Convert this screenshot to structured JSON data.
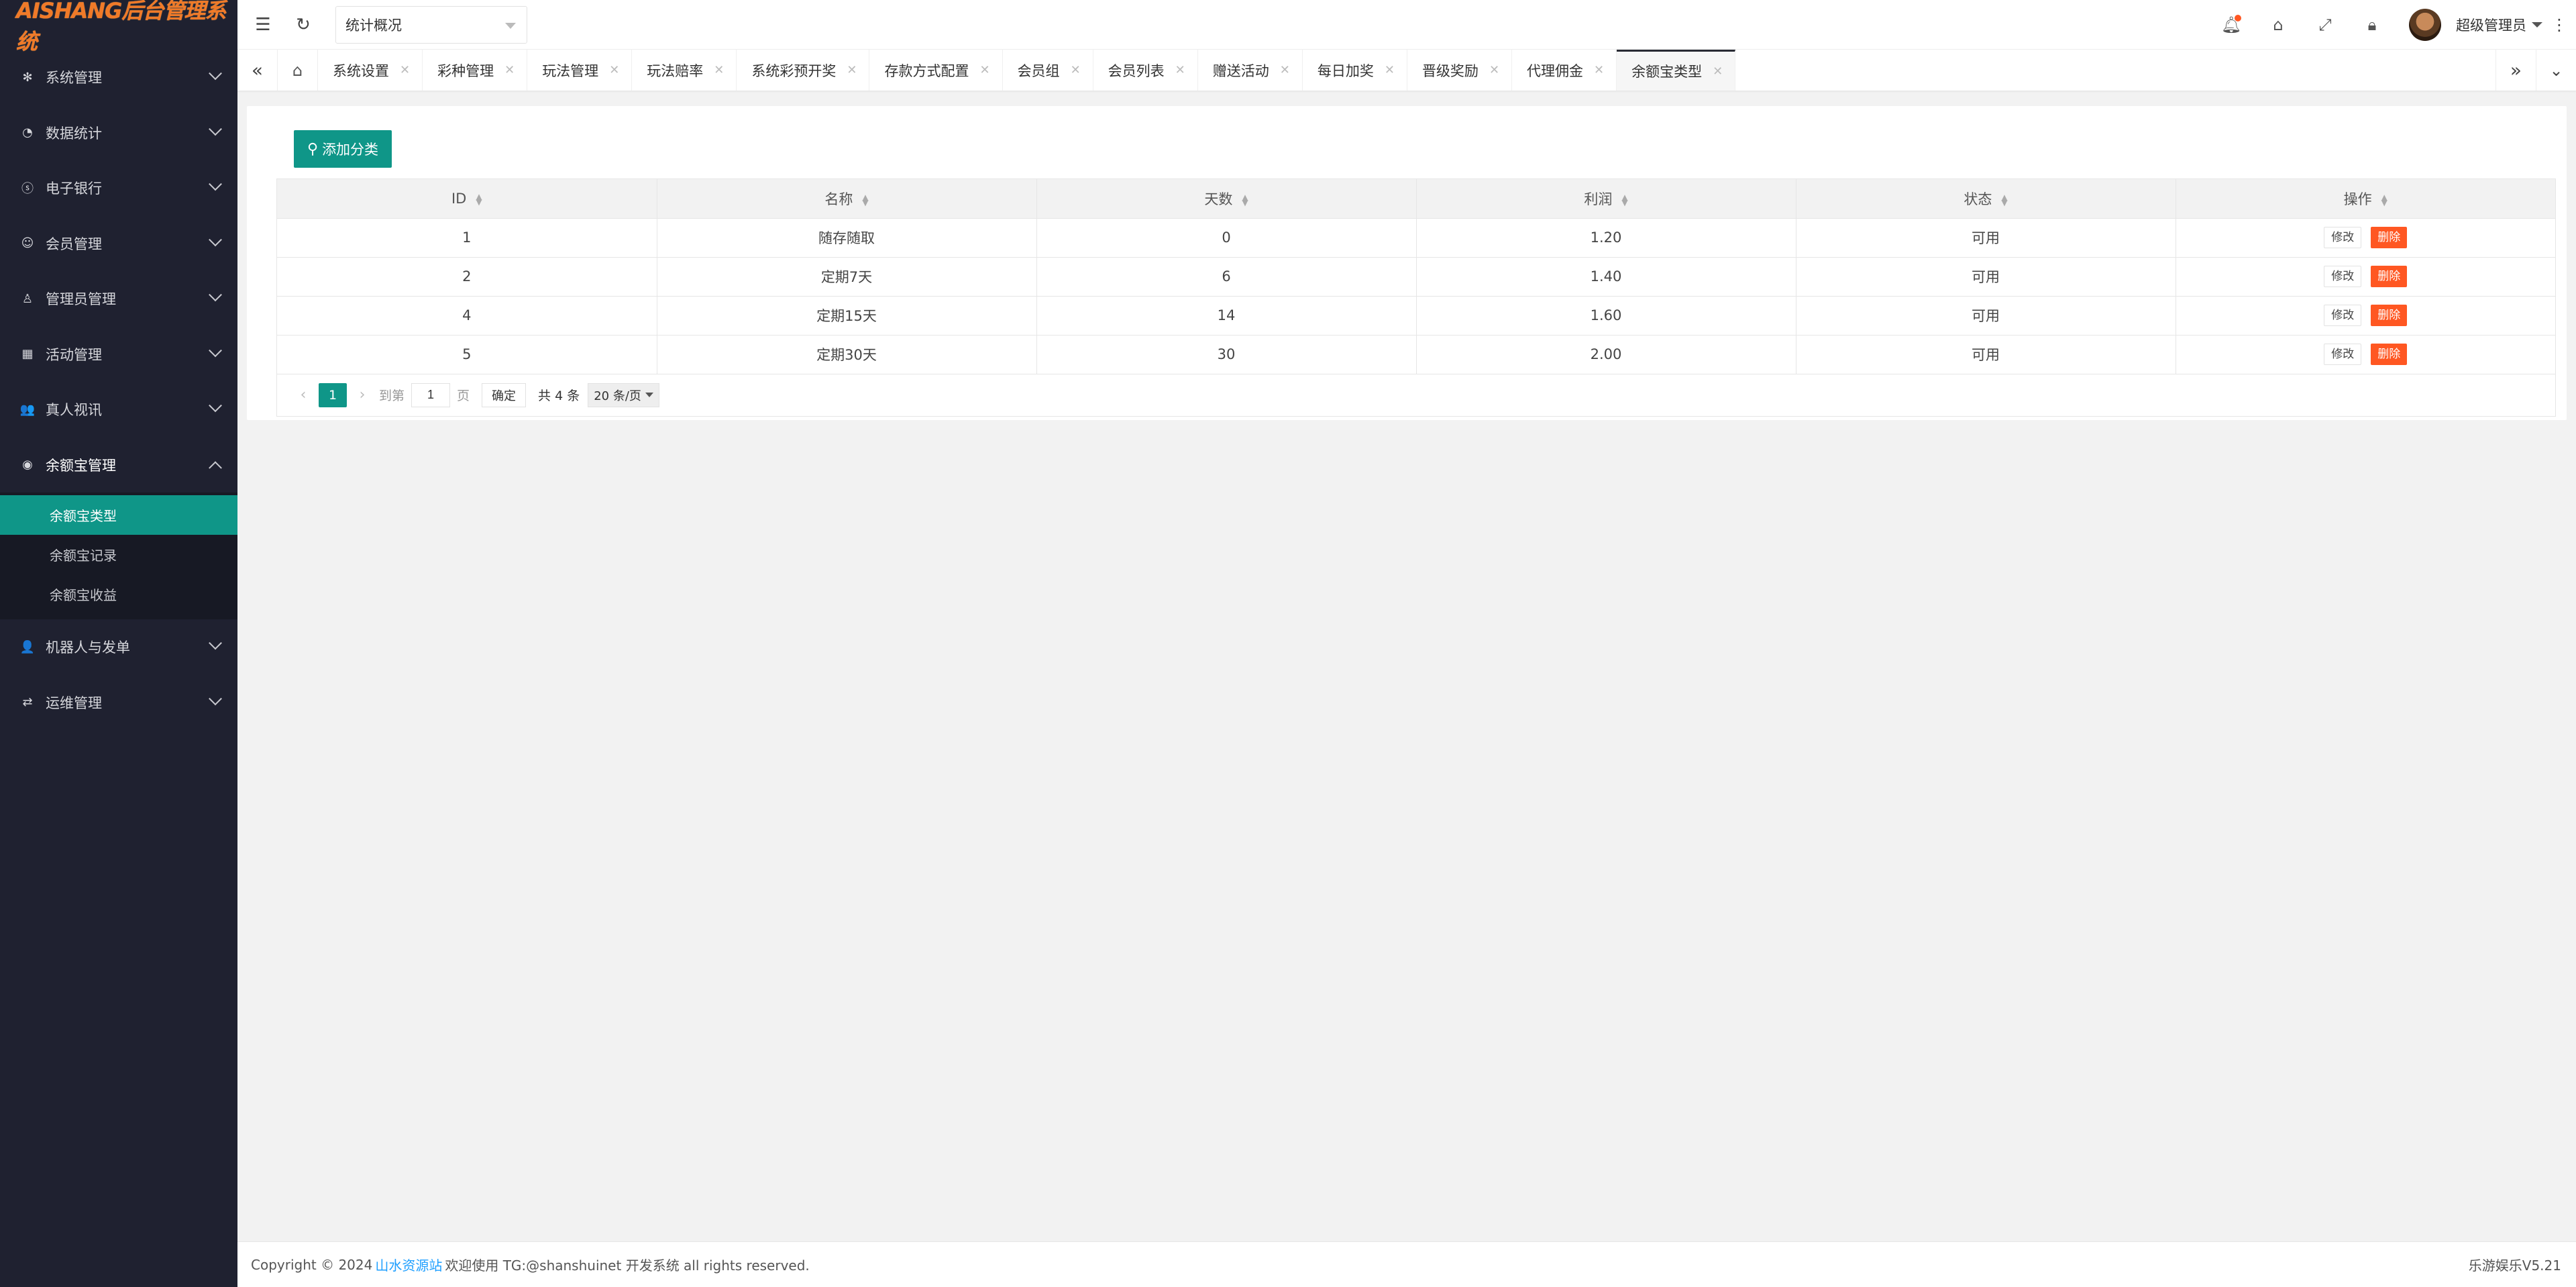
{
  "app": {
    "logo_text": "AISHANG后台管理系统"
  },
  "header": {
    "search_select": "统计概况",
    "user_name": "超级管理员"
  },
  "sidebar": {
    "items": [
      {
        "label": "系统管理",
        "icon": "gear-icon"
      },
      {
        "label": "数据统计",
        "icon": "dashboard-icon"
      },
      {
        "label": "电子银行",
        "icon": "dollar-icon"
      },
      {
        "label": "会员管理",
        "icon": "group-icon"
      },
      {
        "label": "管理员管理",
        "icon": "user-icon"
      },
      {
        "label": "活动管理",
        "icon": "calendar-icon"
      },
      {
        "label": "真人视讯",
        "icon": "users-icon"
      },
      {
        "label": "余额宝管理",
        "icon": "target-icon"
      },
      {
        "label": "机器人与发单",
        "icon": "person-icon"
      },
      {
        "label": "运维管理",
        "icon": "shuffle-icon"
      }
    ],
    "submenu": [
      {
        "label": "余额宝类型"
      },
      {
        "label": "余额宝记录"
      },
      {
        "label": "余额宝收益"
      }
    ]
  },
  "tabs": [
    {
      "label": "系统设置"
    },
    {
      "label": "彩种管理"
    },
    {
      "label": "玩法管理"
    },
    {
      "label": "玩法赔率"
    },
    {
      "label": "系统彩预开奖"
    },
    {
      "label": "存款方式配置"
    },
    {
      "label": "会员组"
    },
    {
      "label": "会员列表"
    },
    {
      "label": "赠送活动"
    },
    {
      "label": "每日加奖"
    },
    {
      "label": "晋级奖励"
    },
    {
      "label": "代理佣金"
    },
    {
      "label": "余额宝类型"
    }
  ],
  "main": {
    "add_button": "添加分类",
    "columns": [
      "ID",
      "名称",
      "天数",
      "利润",
      "状态",
      "操作"
    ],
    "rows": [
      {
        "id": "1",
        "name": "随存随取",
        "days": "0",
        "profit": "1.20",
        "status": "可用"
      },
      {
        "id": "2",
        "name": "定期7天",
        "days": "6",
        "profit": "1.40",
        "status": "可用"
      },
      {
        "id": "4",
        "name": "定期15天",
        "days": "14",
        "profit": "1.60",
        "status": "可用"
      },
      {
        "id": "5",
        "name": "定期30天",
        "days": "30",
        "profit": "2.00",
        "status": "可用"
      }
    ],
    "edit_label": "修改",
    "delete_label": "删除",
    "pager": {
      "current": "1",
      "goto_prefix": "到第",
      "goto_value": "1",
      "goto_suffix": "页",
      "confirm": "确定",
      "total": "共 4 条",
      "page_size": "20 条/页"
    }
  },
  "footer": {
    "copyright": "Copyright © 2024",
    "link_text": "山水资源站",
    "text_after": "欢迎使用 TG:@shanshuinet 开发系统 all rights reserved.",
    "right_text": "乐游娱乐V5.21"
  },
  "colors": {
    "accent": "#0f9688",
    "danger": "#ff5722",
    "sidebar_bg": "#1f2130",
    "link": "#1e9fff",
    "logo": "#f07a28"
  }
}
